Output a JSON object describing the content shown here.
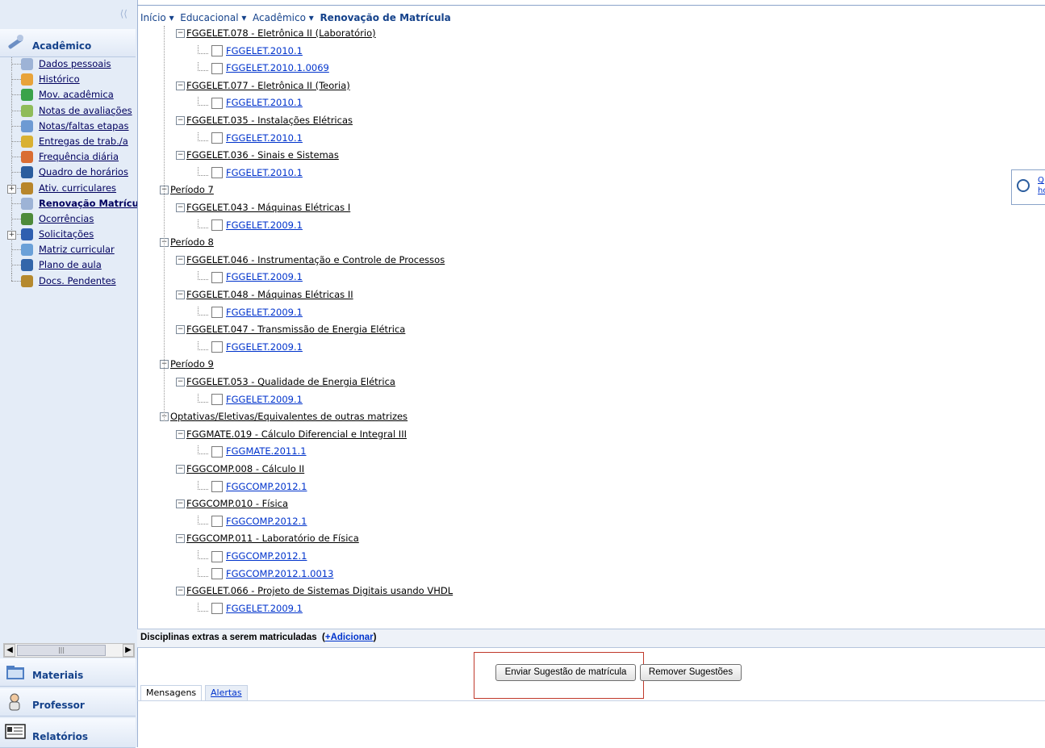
{
  "breadcrumb": {
    "home": "Início ▾",
    "educacional": "Educacional ▾",
    "academico": "Acadêmico ▾",
    "current": "Renovação de Matrícula"
  },
  "sidebar": {
    "section_academico": "Acadêmico",
    "items": [
      {
        "label": "Dados pessoais",
        "icon": "person-icon",
        "color": "#9db3d6"
      },
      {
        "label": "Histórico",
        "icon": "pencil-icon",
        "color": "#e8a33a"
      },
      {
        "label": "Mov. acadêmica",
        "icon": "arrow-icon",
        "color": "#3aa34a"
      },
      {
        "label": "Notas de avaliações",
        "icon": "grades-icon",
        "color": "#8fbc5a"
      },
      {
        "label": "Notas/faltas etapas",
        "icon": "table-icon",
        "color": "#6d9ad3"
      },
      {
        "label": "Entregas de trab./a",
        "icon": "delivery-icon",
        "color": "#d9b133"
      },
      {
        "label": "Frequência diária",
        "icon": "frequency-icon",
        "color": "#d96d33"
      },
      {
        "label": "Quadro de horários",
        "icon": "clock-icon",
        "color": "#2b5d9e"
      },
      {
        "label": "Ativ. curriculares",
        "icon": "activities-icon",
        "color": "#b8862b"
      },
      {
        "label": "Renovação Matrícula",
        "icon": "renewal-icon",
        "color": "#9db3d6"
      },
      {
        "label": "Ocorrências",
        "icon": "occurrences-icon",
        "color": "#4d8a3a"
      },
      {
        "label": "Solicitações",
        "icon": "requests-icon",
        "color": "#2f5fb0"
      },
      {
        "label": "Matriz curricular",
        "icon": "matrix-icon",
        "color": "#6aa0d8"
      },
      {
        "label": "Plano de aula",
        "icon": "book-icon",
        "color": "#3366aa"
      },
      {
        "label": "Docs. Pendentes",
        "icon": "documents-icon",
        "color": "#b5892e"
      }
    ],
    "section_materiais": "Materiais",
    "section_professor": "Professor",
    "section_relatorios": "Relatórios"
  },
  "tree": [
    {
      "level": 1,
      "type": "node",
      "text": "FGGELET.078 - Eletrônica II (Laboratório)"
    },
    {
      "level": 2,
      "type": "leaf",
      "text": "FGGELET.2010.1"
    },
    {
      "level": 2,
      "type": "leaf",
      "text": "FGGELET.2010.1.0069"
    },
    {
      "level": 1,
      "type": "node",
      "text": "FGGELET.077 - Eletrônica II (Teoria)"
    },
    {
      "level": 2,
      "type": "leaf",
      "text": "FGGELET.2010.1"
    },
    {
      "level": 1,
      "type": "node",
      "text": "FGGELET.035 - Instalações Elétricas"
    },
    {
      "level": 2,
      "type": "leaf",
      "text": "FGGELET.2010.1"
    },
    {
      "level": 1,
      "type": "node",
      "text": "FGGELET.036 - Sinais e Sistemas"
    },
    {
      "level": 2,
      "type": "leaf",
      "text": "FGGELET.2010.1"
    },
    {
      "level": 0,
      "type": "node",
      "text": "Período 7"
    },
    {
      "level": 1,
      "type": "node",
      "text": "FGGELET.043 - Máquinas Elétricas I"
    },
    {
      "level": 2,
      "type": "leaf",
      "text": "FGGELET.2009.1"
    },
    {
      "level": 0,
      "type": "node",
      "text": "Período 8"
    },
    {
      "level": 1,
      "type": "node",
      "text": "FGGELET.046 - Instrumentação e Controle de Processos"
    },
    {
      "level": 2,
      "type": "leaf",
      "text": "FGGELET.2009.1"
    },
    {
      "level": 1,
      "type": "node",
      "text": "FGGELET.048 - Máquinas Elétricas II"
    },
    {
      "level": 2,
      "type": "leaf",
      "text": "FGGELET.2009.1"
    },
    {
      "level": 1,
      "type": "node",
      "text": "FGGELET.047 - Transmissão de Energia Elétrica"
    },
    {
      "level": 2,
      "type": "leaf",
      "text": "FGGELET.2009.1"
    },
    {
      "level": 0,
      "type": "node",
      "text": "Período 9"
    },
    {
      "level": 1,
      "type": "node",
      "text": "FGGELET.053 - Qualidade de Energia Elétrica"
    },
    {
      "level": 2,
      "type": "leaf",
      "text": "FGGELET.2009.1"
    },
    {
      "level": 0,
      "type": "node",
      "text": "Optativas/Eletivas/Equivalentes de outras matrizes"
    },
    {
      "level": 1,
      "type": "node",
      "text": "FGGMATE.019 - Cálculo Diferencial e Integral III"
    },
    {
      "level": 2,
      "type": "leaf",
      "text": "FGGMATE.2011.1"
    },
    {
      "level": 1,
      "type": "node",
      "text": "FGGCOMP.008 - Cálculo II"
    },
    {
      "level": 2,
      "type": "leaf",
      "text": "FGGCOMP.2012.1"
    },
    {
      "level": 1,
      "type": "node",
      "text": "FGGCOMP.010 - Física"
    },
    {
      "level": 2,
      "type": "leaf",
      "text": "FGGCOMP.2012.1"
    },
    {
      "level": 1,
      "type": "node",
      "text": "FGGCOMP.011 - Laboratório de Física"
    },
    {
      "level": 2,
      "type": "leaf",
      "text": "FGGCOMP.2012.1"
    },
    {
      "level": 2,
      "type": "leaf",
      "text": "FGGCOMP.2012.1.0013"
    },
    {
      "level": 1,
      "type": "node",
      "text": "FGGELET.066 - Projeto de Sistemas Digitais usando VHDL"
    },
    {
      "level": 2,
      "type": "leaf",
      "text": "FGGELET.2009.1"
    }
  ],
  "right_panel": {
    "line1": "Q",
    "line2": "ho"
  },
  "extras": {
    "label": "Disciplinas extras a serem matriculadas",
    "open_paren": "(",
    "link": "+Adicionar",
    "close_paren": ")"
  },
  "buttons": {
    "send": "Enviar Sugestão de matrícula",
    "remove": "Remover Sugestões"
  },
  "tabs": {
    "messages": "Mensagens",
    "alerts": "Alertas"
  }
}
